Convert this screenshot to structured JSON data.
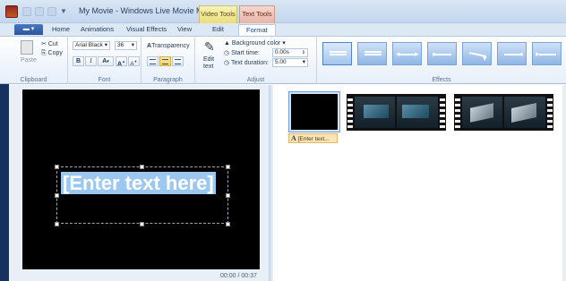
{
  "window": {
    "title": "My Movie - Windows Live Movie Maker",
    "context_tabs": {
      "video_tools": "Video Tools",
      "text_tools": "Text Tools"
    }
  },
  "tabs": {
    "file_menu_icon": "menu-icon",
    "items": [
      "Home",
      "Animations",
      "Visual Effects",
      "View",
      "Edit",
      "Format"
    ],
    "active": "Format"
  },
  "ribbon": {
    "clipboard": {
      "paste_label": "Paste",
      "cut_label": "Cut",
      "copy_label": "Copy",
      "group_label": "Clipboard"
    },
    "font": {
      "family_value": "Arial Black",
      "size_value": "36",
      "bold_label": "B",
      "italic_label": "I",
      "color_label": "A",
      "grow_label": "A",
      "shrink_label": "A",
      "group_label": "Font"
    },
    "paragraph": {
      "transparency_label": "Transparency",
      "group_label": "Paragraph"
    },
    "adjust": {
      "edit_text_label": "Edit",
      "edit_text_label_2": "text",
      "background_color_label": "Background color",
      "start_time_label": "Start time:",
      "start_time_value": "0.00s",
      "text_duration_label": "Text duration:",
      "text_duration_value": "5.00",
      "group_label": "Adjust"
    },
    "effects": {
      "group_label": "Effects",
      "count": 8
    }
  },
  "preview": {
    "caption_text": "[Enter text here]",
    "timecode": "00:00 / 00:37"
  },
  "storyboard": {
    "title_clip_label": "[Enter text..."
  },
  "colors": {
    "caption_highlight": "#9cc8f0",
    "active_context_tab": "#e8b6a8",
    "video_tools_tab": "#e9df7a",
    "selection_label": "#fde4b3"
  }
}
